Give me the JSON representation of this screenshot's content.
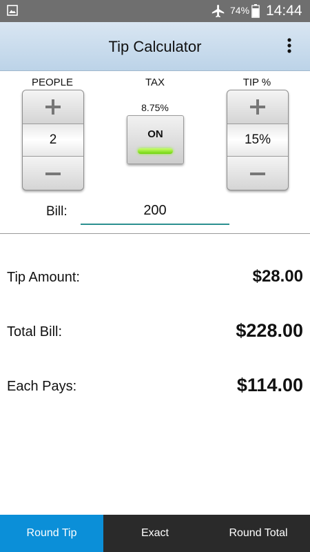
{
  "status_bar": {
    "battery_percent": "74%",
    "time": "14:44",
    "icons": [
      "gallery-icon",
      "airplane-mode-icon",
      "battery-icon"
    ]
  },
  "app_bar": {
    "title": "Tip Calculator",
    "menu_icon": "overflow-menu-icon"
  },
  "people": {
    "label": "PEOPLE",
    "value": "2",
    "plus_icon": "plus-icon",
    "minus_icon": "minus-icon"
  },
  "tax": {
    "label": "TAX",
    "rate": "8.75%",
    "toggle_label": "ON",
    "indicator_color": "#7ddc1a"
  },
  "tip": {
    "label": "TIP %",
    "value": "15%",
    "plus_icon": "plus-icon",
    "minus_icon": "minus-icon"
  },
  "bill": {
    "label": "Bill:",
    "value": "200"
  },
  "results": {
    "tip_amount_label": "Tip Amount:",
    "tip_amount_value": "$28.00",
    "total_bill_label": "Total Bill:",
    "total_bill_value": "$228.00",
    "each_pays_label": "Each Pays:",
    "each_pays_value": "$114.00"
  },
  "tabs": [
    {
      "label": "Round Tip",
      "active": true
    },
    {
      "label": "Exact",
      "active": false
    },
    {
      "label": "Round Total",
      "active": false
    }
  ],
  "colors": {
    "accent": "#0b8fd8",
    "tab_bar": "#2a2a2a",
    "app_bar": "#c8dbed",
    "input_underline": "#2a8f8f"
  }
}
